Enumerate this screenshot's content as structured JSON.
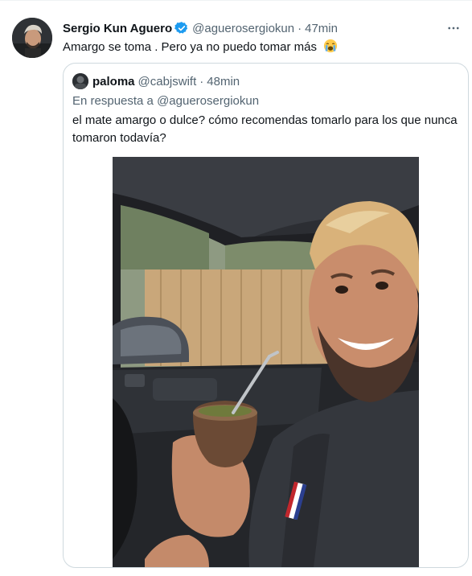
{
  "tweet": {
    "author_name": "Sergio Kun Aguero",
    "handle": "@aguerosergiokun",
    "separator": "·",
    "time": "47min",
    "text": "Amargo se toma . Pero ya no puedo tomar más",
    "emoji_icon": "loudly-crying-face-emoji",
    "verified_color": "#1d9bf0"
  },
  "quote": {
    "author_name": "paloma",
    "handle": "@cabjswift",
    "separator": "·",
    "time": "48min",
    "reply_prefix": "En respuesta a",
    "reply_mention": "@aguerosergiokun",
    "text": "el mate amargo o dulce? cómo recomendas tomarlo para los que nunca tomaron todavía?",
    "media_description_icon": "photo"
  },
  "colors": {
    "text": "#0f1419",
    "secondary": "#536471",
    "border": "#cfd9de",
    "accent": "#1d9bf0"
  }
}
